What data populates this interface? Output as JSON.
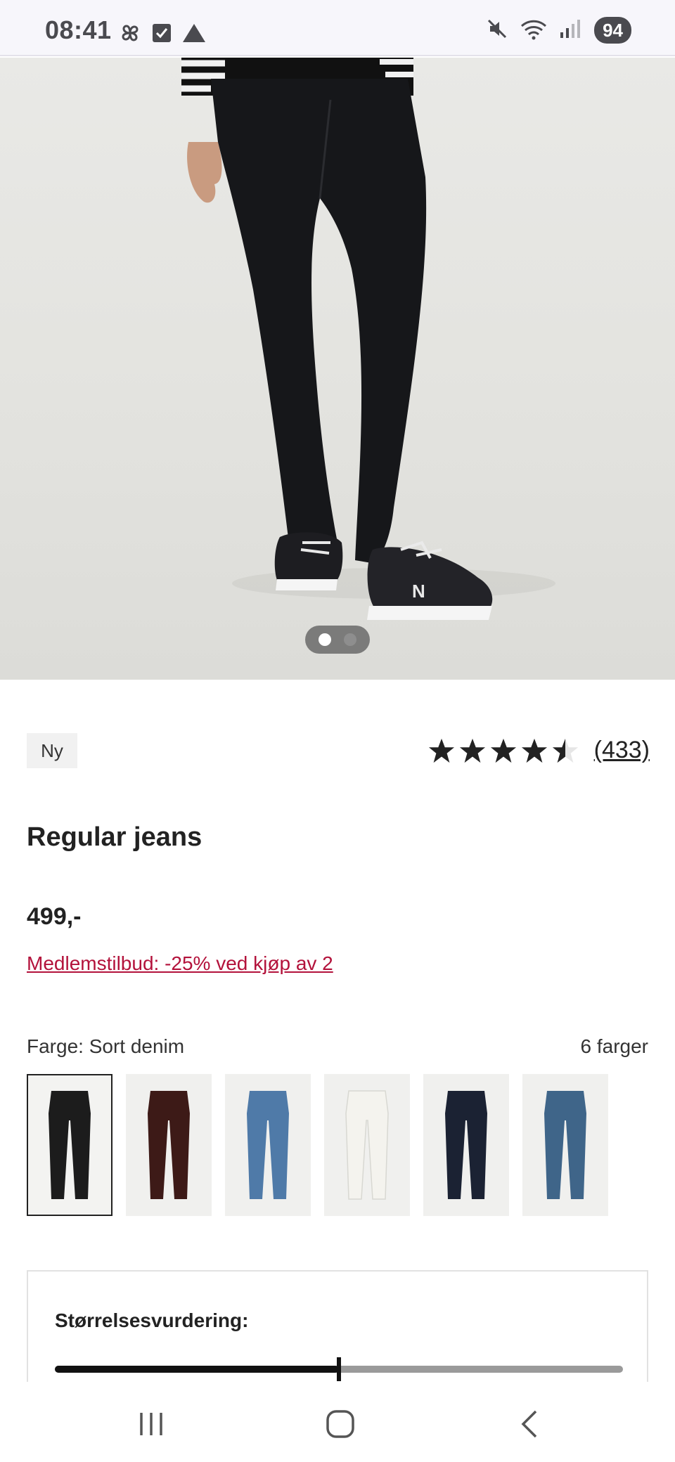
{
  "status_bar": {
    "time": "08:41",
    "left_icons": [
      "pinwheel-icon",
      "checkbox-icon",
      "triangle-icon"
    ],
    "right_icons": [
      "mute-icon",
      "wifi-icon",
      "signal-icon"
    ],
    "battery": "94"
  },
  "gallery": {
    "pages": 2,
    "active_page": 1
  },
  "product": {
    "badge": "Ny",
    "rating_stars": 4.5,
    "review_count": "(433)",
    "title": "Regular jeans",
    "price": "499,-",
    "offer": "Medlemstilbud: -25% ved kjøp av 2"
  },
  "colors": {
    "label": "Farge: Sort denim",
    "count": "6 farger",
    "swatches": [
      {
        "name": "sort-denim",
        "color": "#1c1c1c",
        "selected": true
      },
      {
        "name": "brown",
        "color": "#3d1a17",
        "selected": false
      },
      {
        "name": "light-blue",
        "color": "#4f7aa8",
        "selected": false
      },
      {
        "name": "white",
        "color": "#f4f3ee",
        "selected": false
      },
      {
        "name": "dark-navy",
        "color": "#1b2233",
        "selected": false
      },
      {
        "name": "mid-blue",
        "color": "#3f6589",
        "selected": false
      }
    ]
  },
  "size_rating": {
    "title": "Størrelsesvurdering:",
    "value_fraction": 0.5
  },
  "accent_colors": {
    "offer_red": "#b3123b",
    "text_dark": "#222222"
  }
}
